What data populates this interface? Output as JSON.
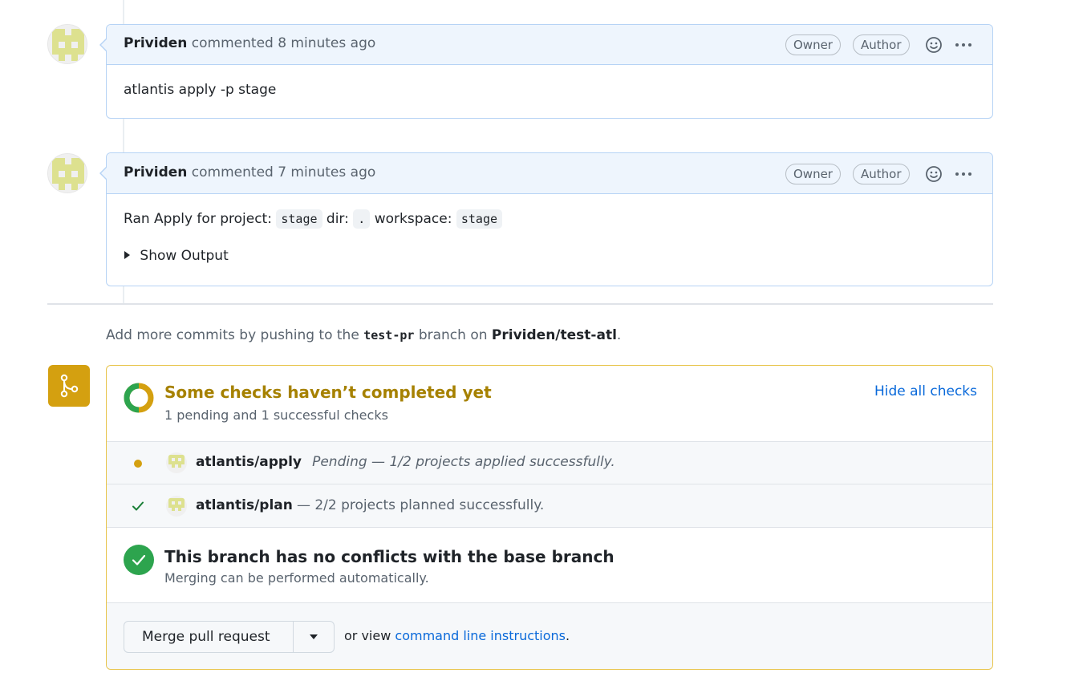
{
  "comments": [
    {
      "author": "Prividen",
      "meta": "commented 8 minutes ago",
      "badges": [
        "Owner",
        "Author"
      ],
      "body": "atlantis apply -p stage"
    },
    {
      "author": "Prividen",
      "meta": "commented 7 minutes ago",
      "badges": [
        "Owner",
        "Author"
      ],
      "body_parts": {
        "t1": "Ran Apply for project:",
        "project": "stage",
        "t2": "dir:",
        "dir": ".",
        "t3": "workspace:",
        "workspace": "stage"
      },
      "details_summary": "Show Output"
    }
  ],
  "push_note": {
    "prefix": "Add more commits by pushing to the",
    "branch": "test-pr",
    "middle": "branch on",
    "repo": "Prividen/test-atl",
    "suffix": "."
  },
  "checks": {
    "title": "Some checks haven’t completed yet",
    "subtitle": "1 pending and 1 successful checks",
    "toggle_link": "Hide all checks",
    "items": [
      {
        "name": "atlantis/apply",
        "description": "Pending — 1/2 projects applied successfully.",
        "status": "pending",
        "status_color": "#d4a010"
      },
      {
        "name": "atlantis/plan",
        "description": "— 2/2 projects planned successfully.",
        "status": "success",
        "status_color": "#1a7f37"
      }
    ]
  },
  "conflicts": {
    "title": "This branch has no conflicts with the base branch",
    "subtitle": "Merging can be performed automatically."
  },
  "merge": {
    "button_label": "Merge pull request",
    "or_view": "or view",
    "cli_link": "command line instructions",
    "cli_suffix": "."
  },
  "icons": {
    "reaction": "smiley-icon",
    "more": "kebab-horizontal-icon",
    "merge": "git-merge-icon",
    "check": "check-icon",
    "dropdown": "triangle-down-icon"
  },
  "colors": {
    "warning": "#d4a010",
    "success": "#1a7f37",
    "success_circle": "#2da44e",
    "link": "#0969da",
    "comment_border": "#b6d3f5",
    "comment_header_bg": "#eef5fd"
  }
}
